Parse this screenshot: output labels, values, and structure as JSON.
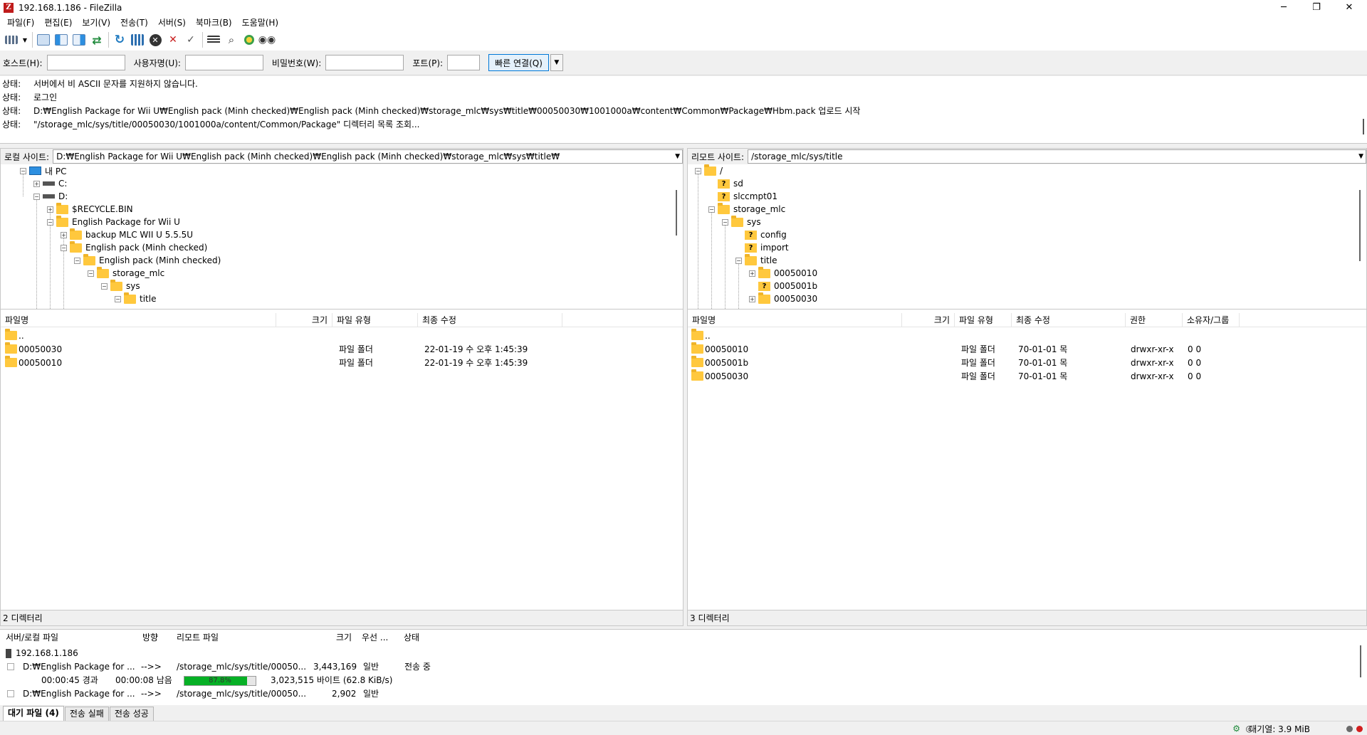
{
  "window": {
    "title": "192.168.1.186 - FileZilla",
    "controls": [
      "─",
      "❐",
      "✕"
    ]
  },
  "menu": [
    "파일(F)",
    "편집(E)",
    "보기(V)",
    "전송(T)",
    "서버(S)",
    "북마크(B)",
    "도움말(H)"
  ],
  "toolbar": {
    "icons": [
      "site-manager-icon",
      "dropdown-icon",
      "toggle-log-icon",
      "toggle-local-tree-icon",
      "toggle-remote-tree-icon",
      "toggle-queue-icon",
      "refresh-icon",
      "process-queue-icon",
      "cancel-icon",
      "disconnect-icon",
      "reconnect-icon",
      "filter-icon",
      "compare-icon",
      "sync-browse-icon",
      "search-icon"
    ],
    "colors": {
      "accent": "#0078d7",
      "refresh": "#1f8a3b",
      "cancel": "#333333"
    }
  },
  "quickconnect": {
    "host_label": "호스트(H):",
    "user_label": "사용자명(U):",
    "pass_label": "비밀번호(W):",
    "port_label": "포트(P):",
    "host_value": "",
    "user_value": "",
    "pass_value": "",
    "port_value": "",
    "connect_label": "빠른 연결(Q)"
  },
  "log": [
    {
      "label": "상태:",
      "text": "서버에서 비 ASCII 문자를 지원하지 않습니다."
    },
    {
      "label": "상태:",
      "text": "로그인"
    },
    {
      "label": "상태:",
      "text": "D:₩English Package for Wii U₩English pack (Minh checked)₩English pack (Minh checked)₩storage_mlc₩sys₩title₩00050030₩1001000a₩content₩Common₩Package₩Hbm.pack 업로드 시작"
    },
    {
      "label": "상태:",
      "text": "\"/storage_mlc/sys/title/00050030/1001000a/content/Common/Package\" 디렉터리 목록 조회..."
    }
  ],
  "local": {
    "site_label": "로컬 사이트:",
    "path": "D:₩English Package for Wii U₩English pack (Minh checked)₩English pack (Minh checked)₩storage_mlc₩sys₩title₩",
    "tree": [
      {
        "label": "내 PC",
        "icon": "pc",
        "exp": "−"
      },
      {
        "label": "C:",
        "icon": "drive",
        "exp": "+"
      },
      {
        "label": "D:",
        "icon": "drive",
        "exp": "−"
      },
      {
        "label": "$RECYCLE.BIN",
        "icon": "folder",
        "exp": "+"
      },
      {
        "label": "English Package for Wii U",
        "icon": "folder",
        "exp": "−"
      },
      {
        "label": "backup MLC WII U 5.5.5U",
        "icon": "folder",
        "exp": "+"
      },
      {
        "label": "English pack (Minh checked)",
        "icon": "folder",
        "exp": "−"
      },
      {
        "label": "English pack (Minh checked)",
        "icon": "folder",
        "exp": "−"
      },
      {
        "label": "storage_mlc",
        "icon": "folder",
        "exp": "−"
      },
      {
        "label": "sys",
        "icon": "folder",
        "exp": "−"
      },
      {
        "label": "title",
        "icon": "folder",
        "exp": "−"
      }
    ],
    "columns": [
      "파일명",
      "크기",
      "파일 유형",
      "최종 수정"
    ],
    "files": [
      {
        "name": "..",
        "size": "",
        "type": "",
        "modified": ""
      },
      {
        "name": "00050030",
        "size": "",
        "type": "파일 폴더",
        "modified": "22-01-19 수 오후 1:45:39"
      },
      {
        "name": "00050010",
        "size": "",
        "type": "파일 폴더",
        "modified": "22-01-19 수 오후 1:45:39"
      }
    ],
    "status": "2 디렉터리"
  },
  "remote": {
    "site_label": "리모트 사이트:",
    "path": "/storage_mlc/sys/title",
    "tree": [
      {
        "label": "/",
        "icon": "folder",
        "exp": "−"
      },
      {
        "label": "sd",
        "icon": "qfolder",
        "exp": ""
      },
      {
        "label": "slccmpt01",
        "icon": "qfolder",
        "exp": ""
      },
      {
        "label": "storage_mlc",
        "icon": "folder",
        "exp": "−"
      },
      {
        "label": "sys",
        "icon": "folder",
        "exp": "−"
      },
      {
        "label": "config",
        "icon": "qfolder",
        "exp": ""
      },
      {
        "label": "import",
        "icon": "qfolder",
        "exp": ""
      },
      {
        "label": "title",
        "icon": "folder",
        "exp": "−"
      },
      {
        "label": "00050010",
        "icon": "folder",
        "exp": "+"
      },
      {
        "label": "0005001b",
        "icon": "qfolder",
        "exp": ""
      },
      {
        "label": "00050030",
        "icon": "folder",
        "exp": "+"
      }
    ],
    "columns": [
      "파일명",
      "크기",
      "파일 유형",
      "최종 수정",
      "권한",
      "소유자/그룹"
    ],
    "files": [
      {
        "name": "..",
        "size": "",
        "type": "",
        "modified": "",
        "perm": "",
        "owner": ""
      },
      {
        "name": "00050010",
        "size": "",
        "type": "파일 폴더",
        "modified": "70-01-01 목",
        "perm": "drwxr-xr-x",
        "owner": "0 0"
      },
      {
        "name": "0005001b",
        "size": "",
        "type": "파일 폴더",
        "modified": "70-01-01 목",
        "perm": "drwxr-xr-x",
        "owner": "0 0"
      },
      {
        "name": "00050030",
        "size": "",
        "type": "파일 폴더",
        "modified": "70-01-01 목",
        "perm": "drwxr-xr-x",
        "owner": "0 0"
      }
    ],
    "status": "3 디렉터리"
  },
  "queue": {
    "columns": [
      "서버/로컬 파일",
      "방향",
      "리모트 파일",
      "크기",
      "우선 ...",
      "상태"
    ],
    "server": "192.168.1.186",
    "items": [
      {
        "local": "D:₩English Package for ...",
        "dir": "-->>",
        "remote": "/storage_mlc/sys/title/00050...",
        "size": "3,443,169",
        "priority": "일반",
        "status": "전송 중"
      },
      {
        "local": "D:₩English Package for ...",
        "dir": "-->>",
        "remote": "/storage_mlc/sys/title/00050...",
        "size": "2,902",
        "priority": "일반",
        "status": ""
      }
    ],
    "progress": {
      "elapsed": "00:00:45 경과",
      "remaining": "00:00:08 남음",
      "percent_text": "87.8%",
      "percent": 87.8,
      "bytes": "3,023,515 바이트 (62.8 KiB/s)"
    },
    "tabs": [
      "대기 파일 (4)",
      "전송 실패",
      "전송 성공"
    ]
  },
  "statusbar": {
    "queue_size": "대기열: 3.9 MiB"
  }
}
